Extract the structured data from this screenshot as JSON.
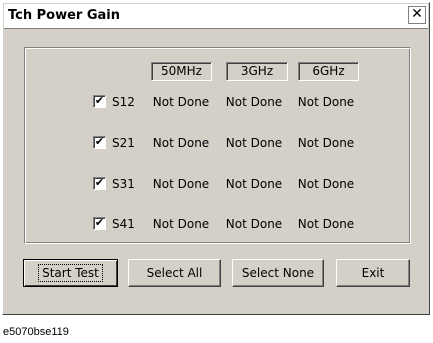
{
  "window": {
    "title": "Tch Power Gain",
    "close_glyph": "✕"
  },
  "columns": [
    "50MHz",
    "3GHz",
    "6GHz"
  ],
  "rows": [
    {
      "checked": true,
      "label": "S12",
      "status": [
        "Not Done",
        "Not Done",
        "Not Done"
      ]
    },
    {
      "checked": true,
      "label": "S21",
      "status": [
        "Not Done",
        "Not Done",
        "Not Done"
      ]
    },
    {
      "checked": true,
      "label": "S31",
      "status": [
        "Not Done",
        "Not Done",
        "Not Done"
      ]
    },
    {
      "checked": true,
      "label": "S41",
      "status": [
        "Not Done",
        "Not Done",
        "Not Done"
      ]
    }
  ],
  "check_glyph": "✔",
  "buttons": {
    "start_test": "Start Test",
    "select_all": "Select All",
    "select_none": "Select None",
    "exit": "Exit"
  },
  "figure_caption": "e5070bse119"
}
